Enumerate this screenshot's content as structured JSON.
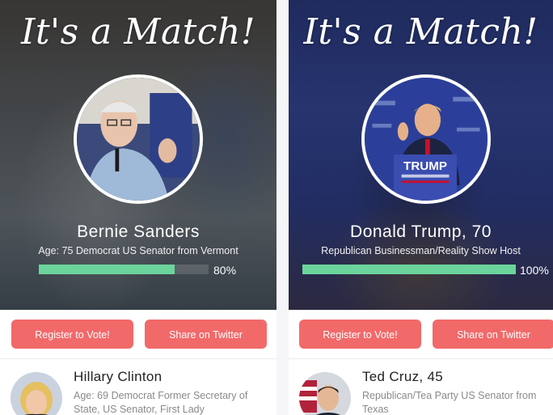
{
  "cards": [
    {
      "match_title": "It's a Match!",
      "name": "Bernie Sanders",
      "bio": "Age: 75 Democrat US Senator from Vermont",
      "match_percent_label": "80%",
      "match_percent": 80,
      "register_label": "Register to Vote!",
      "share_label": "Share on Twitter",
      "next_candidate": {
        "name": "Hillary Clinton",
        "bio": "Age: 69 Democrat Former Secretary of State, US Senator, First Lady"
      }
    },
    {
      "match_title": "It's a Match!",
      "name": "Donald Trump, 70",
      "bio": "Republican Businessman/Reality Show Host",
      "match_percent_label": "100%",
      "match_percent": 100,
      "register_label": "Register to Vote!",
      "share_label": "Share on Twitter",
      "podium_sign": "TRUMP",
      "next_candidate": {
        "name": "Ted Cruz, 45",
        "bio": "Republican/Tea Party US Senator from Texas"
      }
    }
  ],
  "colors": {
    "button": "#f2696a",
    "progress": "#6bd49c"
  }
}
